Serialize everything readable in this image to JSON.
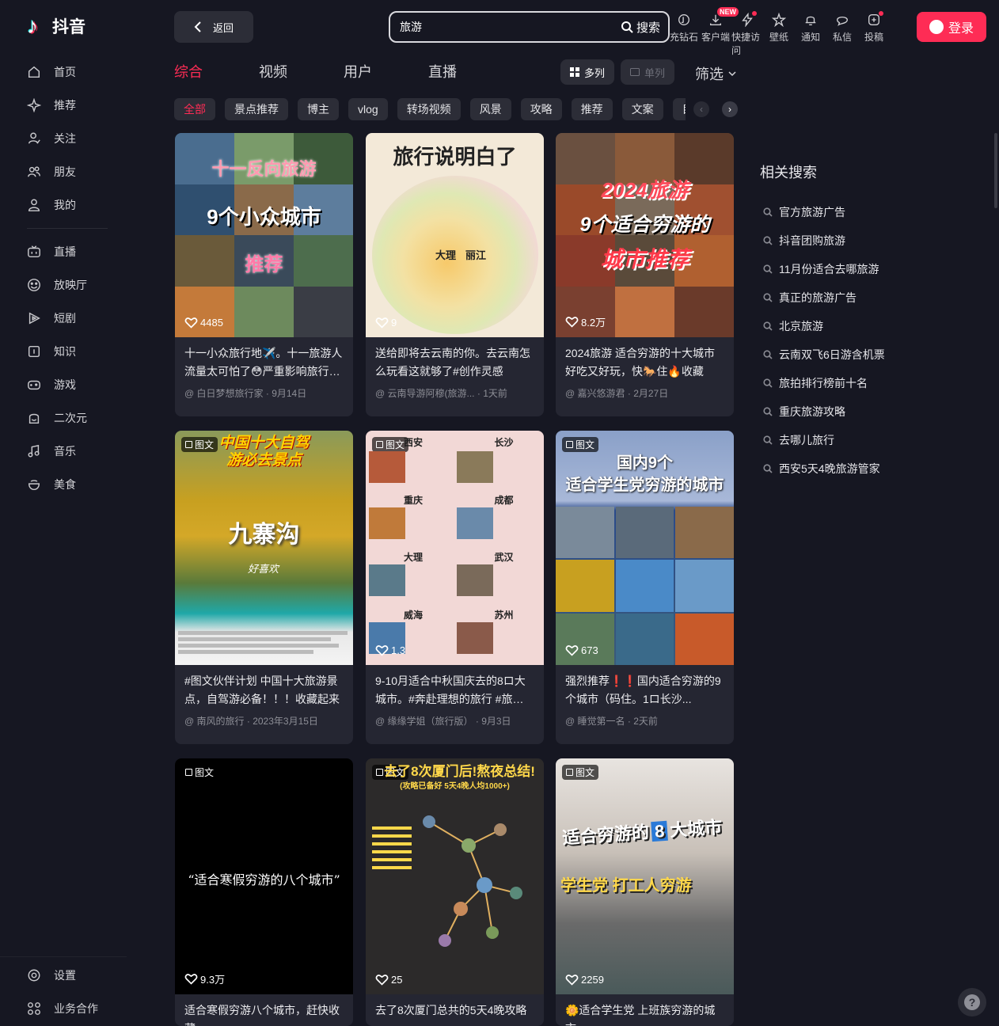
{
  "app": {
    "logo_text": "抖音"
  },
  "sidebar": {
    "items": [
      {
        "label": "首页",
        "icon": "home-icon"
      },
      {
        "label": "推荐",
        "icon": "sparkle-icon"
      },
      {
        "label": "关注",
        "icon": "follow-icon"
      },
      {
        "label": "朋友",
        "icon": "friends-icon"
      },
      {
        "label": "我的",
        "icon": "user-icon"
      },
      {
        "label": "直播",
        "icon": "tv-icon"
      },
      {
        "label": "放映厅",
        "icon": "film-icon"
      },
      {
        "label": "短剧",
        "icon": "play-icon"
      },
      {
        "label": "知识",
        "icon": "knowledge-icon"
      },
      {
        "label": "游戏",
        "icon": "gamepad-icon"
      },
      {
        "label": "二次元",
        "icon": "anime-icon"
      },
      {
        "label": "音乐",
        "icon": "music-icon"
      },
      {
        "label": "美食",
        "icon": "food-icon"
      }
    ],
    "bottom": [
      {
        "label": "设置",
        "icon": "settings-icon"
      },
      {
        "label": "业务合作",
        "icon": "grid-icon"
      }
    ]
  },
  "header": {
    "back_label": "返回",
    "search_value": "旅游",
    "search_button": "搜索",
    "icons": [
      {
        "label": "充钻石",
        "icon": "diamond-icon",
        "badge": ""
      },
      {
        "label": "客户端",
        "icon": "download-icon",
        "badge": "NEW"
      },
      {
        "label": "快捷访问",
        "icon": "bolt-icon",
        "badge": "dot"
      },
      {
        "label": "壁纸",
        "icon": "wallpaper-icon",
        "badge": ""
      },
      {
        "label": "通知",
        "icon": "bell-icon",
        "badge": ""
      },
      {
        "label": "私信",
        "icon": "message-icon",
        "badge": ""
      },
      {
        "label": "投稿",
        "icon": "upload-icon",
        "badge": "dot"
      }
    ],
    "login_label": "登录"
  },
  "tabs": [
    "综合",
    "视频",
    "用户",
    "直播"
  ],
  "view_toggle": {
    "multi": "多列",
    "single": "单列"
  },
  "filter_label": "筛选",
  "chips": [
    "全部",
    "景点推荐",
    "博主",
    "vlog",
    "转场视频",
    "风景",
    "攻略",
    "推荐",
    "文案",
    "目的地"
  ],
  "cards": [
    {
      "title": "十一小众旅行地✈️。十一旅游人流量太可怕了😳严重影响旅行体验",
      "author": "@ 白日梦想旅行家",
      "date": "· 9月14日",
      "likes": "4485",
      "tag": "",
      "overlay": [
        "十一反向旅游",
        "9个小众城市",
        "推荐"
      ]
    },
    {
      "title": "送给即将去云南的你。去云南怎么玩看这就够了#创作灵感",
      "author": "@ 云南导游阿穆(旅游...",
      "date": "· 1天前",
      "likes": "9",
      "tag": "",
      "overlay": [
        "旅行说明白了",
        "大理",
        "丽江"
      ]
    },
    {
      "title": "2024旅游 适合穷游的十大城市 好吃又好玩，快🐎住🔥收藏",
      "author": "@ 嘉兴悠游君",
      "date": "· 2月27日",
      "likes": "8.2万",
      "tag": "",
      "overlay": [
        "2024旅游",
        "9个适合穷游的",
        "城市推荐"
      ]
    },
    {
      "title": "#图文伙伴计划 中国十大旅游景点，自驾游必备！！！收藏起来",
      "author": "@ 南风的旅行",
      "date": "· 2023年3月15日",
      "likes": "",
      "tag": "图文",
      "overlay": [
        "中国十大自驾",
        "游必去景点",
        "九寨沟",
        "好喜欢"
      ]
    },
    {
      "title": "9-10月适合中秋国庆去的8ロ大城市。#奔赴理想的旅行 #旅游推荐",
      "author": "@ 缘缘学姐（旅行版）",
      "date": "· 9月3日",
      "likes": "1.3",
      "tag": "图文",
      "overlay": [
        "西安",
        "长沙",
        "重庆",
        "成都",
        "大理",
        "武汉",
        "威海",
        "苏州"
      ]
    },
    {
      "title": "强烈推荐❗❗国内适合穷游的9个城市（码住。1ロ长沙...",
      "author": "@ 睡觉第一名",
      "date": "· 2天前",
      "likes": "673",
      "tag": "图文",
      "overlay": [
        "国内9个",
        "适合学生党穷游的城市"
      ]
    },
    {
      "title": "适合寒假穷游八个城市，赶快收藏",
      "author": "",
      "date": "",
      "likes": "9.3万",
      "tag": "图文",
      "overlay": [
        "“适合寒假穷游的八个城市”"
      ]
    },
    {
      "title": "去了8次厦门总共的5天4晚攻略",
      "author": "",
      "date": "",
      "likes": "25",
      "tag": "图文",
      "overlay": [
        "去了8次厦门后!熬夜总结!",
        "(攻略已备好 5天4晚人均1000+)"
      ]
    },
    {
      "title": "🌼适合学生党 上班族穷游的城市",
      "author": "",
      "date": "",
      "likes": "2259",
      "tag": "图文",
      "overlay": [
        "适合穷游的",
        "8",
        "大城市",
        "学生党 打工人穷游"
      ]
    }
  ],
  "related": {
    "title": "相关搜索",
    "items": [
      "官方旅游广告",
      "抖音团购旅游",
      "11月份适合去哪旅游",
      "真正的旅游广告",
      "北京旅游",
      "云南双飞6日游含机票",
      "旅拍排行榜前十名",
      "重庆旅游攻略",
      "去哪儿旅行",
      "西安5天4晚旅游管家"
    ]
  },
  "colors": {
    "accent": "#fe2c55",
    "bg": "#161722",
    "card_bg": "#252632"
  }
}
